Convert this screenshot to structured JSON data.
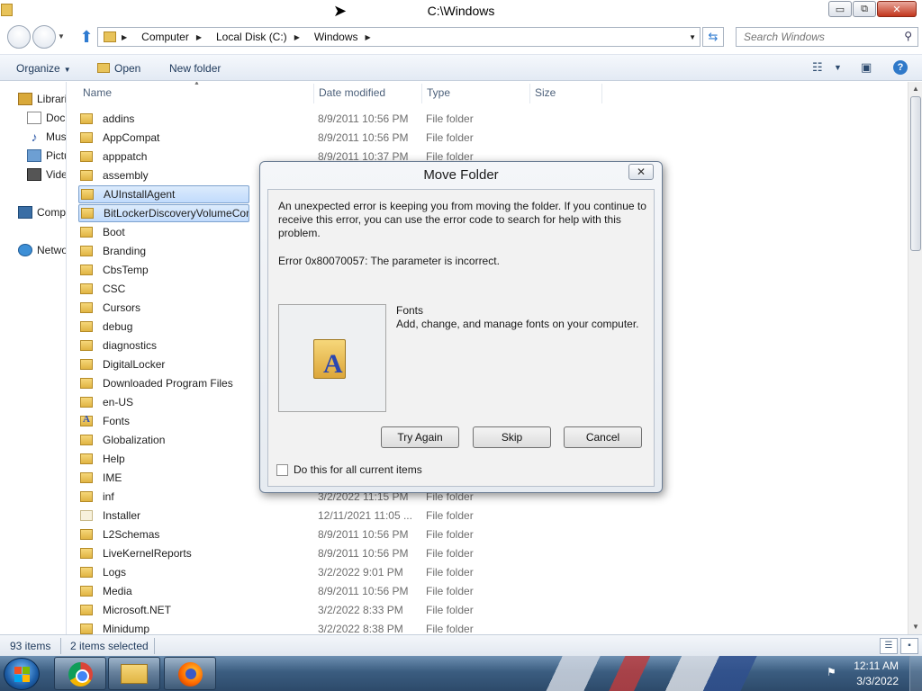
{
  "window": {
    "title": "C:\\Windows",
    "minimize": "▭",
    "maximize": "⧉",
    "close": "✕"
  },
  "address": {
    "crumbs": [
      "Computer",
      "Local Disk (C:)",
      "Windows"
    ],
    "search_placeholder": "Search Windows"
  },
  "commandbar": {
    "organize": "Organize",
    "open": "Open",
    "new_folder": "New folder"
  },
  "navpane": {
    "items": [
      {
        "label": "Libraries",
        "icon": "library-icon"
      },
      {
        "label": "Documents",
        "icon": "documents-icon"
      },
      {
        "label": "Music",
        "icon": "music-icon"
      },
      {
        "label": "Pictures",
        "icon": "pictures-icon"
      },
      {
        "label": "Videos",
        "icon": "videos-icon"
      },
      {
        "label": "Computer",
        "icon": "computer-icon"
      },
      {
        "label": "Network",
        "icon": "network-icon"
      }
    ]
  },
  "filelist": {
    "columns": {
      "name": "Name",
      "date": "Date modified",
      "type": "Type",
      "size": "Size"
    },
    "rows": [
      {
        "name": "addins",
        "date": "8/9/2011 10:56 PM",
        "type": "File folder"
      },
      {
        "name": "AppCompat",
        "date": "8/9/2011 10:56 PM",
        "type": "File folder"
      },
      {
        "name": "apppatch",
        "date": "8/9/2011 10:37 PM",
        "type": "File folder"
      },
      {
        "name": "assembly",
        "date": "",
        "type": ""
      },
      {
        "name": "AUInstallAgent",
        "date": "",
        "type": "",
        "selected": true
      },
      {
        "name": "BitLockerDiscoveryVolumeContents",
        "date": "",
        "type": "",
        "selected": true
      },
      {
        "name": "Boot",
        "date": "",
        "type": ""
      },
      {
        "name": "Branding",
        "date": "",
        "type": ""
      },
      {
        "name": "CbsTemp",
        "date": "",
        "type": ""
      },
      {
        "name": "CSC",
        "date": "",
        "type": ""
      },
      {
        "name": "Cursors",
        "date": "",
        "type": ""
      },
      {
        "name": "debug",
        "date": "",
        "type": ""
      },
      {
        "name": "diagnostics",
        "date": "",
        "type": ""
      },
      {
        "name": "DigitalLocker",
        "date": "",
        "type": ""
      },
      {
        "name": "Downloaded Program Files",
        "date": "",
        "type": ""
      },
      {
        "name": "en-US",
        "date": "",
        "type": ""
      },
      {
        "name": "Fonts",
        "date": "",
        "type": "",
        "icon": "fonts"
      },
      {
        "name": "Globalization",
        "date": "",
        "type": ""
      },
      {
        "name": "Help",
        "date": "",
        "type": ""
      },
      {
        "name": "IME",
        "date": "",
        "type": ""
      },
      {
        "name": "inf",
        "date": "3/2/2022 11:15 PM",
        "type": "File folder"
      },
      {
        "name": "Installer",
        "date": "12/11/2021 11:05 ...",
        "type": "File folder",
        "icon": "plain"
      },
      {
        "name": "L2Schemas",
        "date": "8/9/2011 10:56 PM",
        "type": "File folder"
      },
      {
        "name": "LiveKernelReports",
        "date": "8/9/2011 10:56 PM",
        "type": "File folder"
      },
      {
        "name": "Logs",
        "date": "3/2/2022 9:01 PM",
        "type": "File folder"
      },
      {
        "name": "Media",
        "date": "8/9/2011 10:56 PM",
        "type": "File folder"
      },
      {
        "name": "Microsoft.NET",
        "date": "3/2/2022 8:33 PM",
        "type": "File folder"
      },
      {
        "name": "Minidump",
        "date": "3/2/2022 8:38 PM",
        "type": "File folder"
      }
    ]
  },
  "statusbar": {
    "count": "93 items",
    "selected": "2 items selected"
  },
  "dialog": {
    "title": "Move Folder",
    "close": "✕",
    "message": "An unexpected error is keeping you from moving the folder. If you continue to receive this error, you can use the error code to search for help with this problem.",
    "error": "Error 0x80070057: The parameter is incorrect.",
    "item_name": "Fonts",
    "item_desc": "Add, change, and manage fonts on your computer.",
    "buttons": {
      "try_again": "Try Again",
      "skip": "Skip",
      "cancel": "Cancel"
    },
    "checkbox_label": "Do this for all current items"
  },
  "taskbar": {
    "time": "12:11 AM",
    "date": "3/3/2022"
  }
}
